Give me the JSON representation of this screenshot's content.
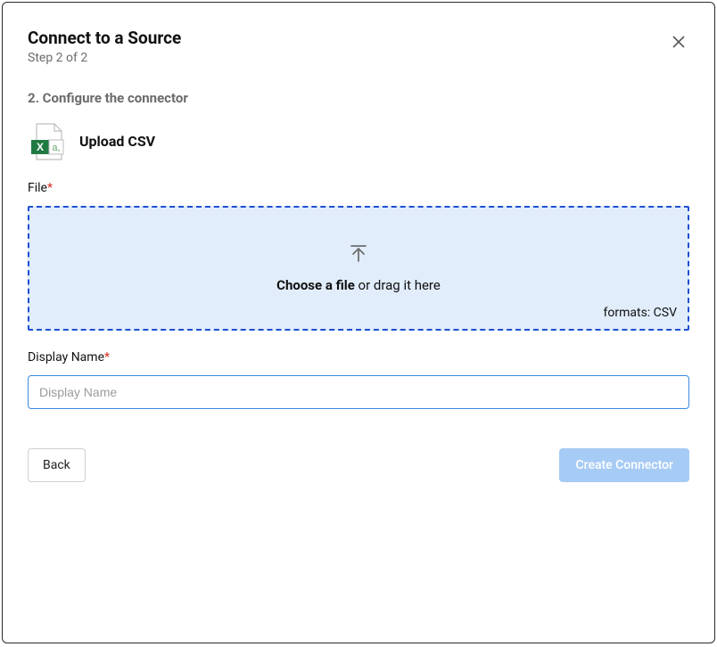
{
  "header": {
    "title": "Connect to a Source",
    "step": "Step 2 of 2"
  },
  "section_heading": "2. Configure the connector",
  "connector": {
    "name": "Upload CSV"
  },
  "file_field": {
    "label": "File",
    "choose_bold": "Choose a file",
    "choose_rest": " or drag it here",
    "formats": "formats: CSV"
  },
  "display_name_field": {
    "label": "Display Name",
    "placeholder": "Display Name",
    "value": ""
  },
  "buttons": {
    "back": "Back",
    "create": "Create Connector"
  }
}
